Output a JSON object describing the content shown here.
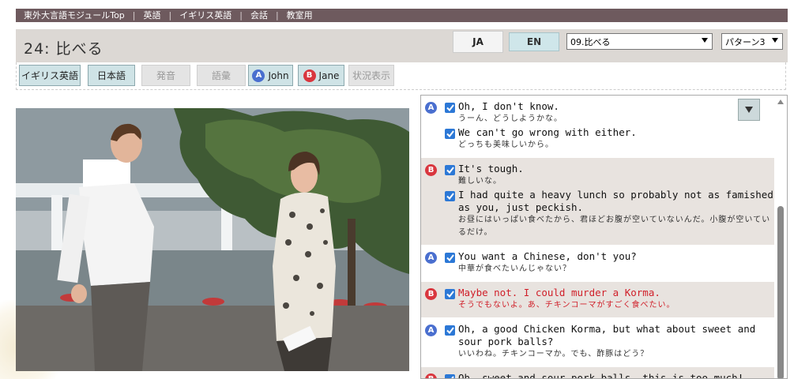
{
  "nav": {
    "items": [
      "東外大言語モジュールTop",
      "英語",
      "イギリス英語",
      "会話",
      "教室用"
    ]
  },
  "header": {
    "title": "24: 比べる",
    "lang_ja": "JA",
    "lang_en": "EN",
    "chapter_select": "09.比べる",
    "pattern_select": "パターン3"
  },
  "toolbar": {
    "british": "イギリス英語",
    "japanese": "日本語",
    "pronunciation": "発音",
    "vocabulary": "語彙",
    "john": "John",
    "jane": "Jane",
    "situation": "状況表示",
    "badge_a": "A",
    "badge_b": "B"
  },
  "transcript": {
    "groups": [
      {
        "speaker": "A",
        "lines": [
          {
            "en": "Oh, I don't know.",
            "ja": "うーん、どうしようかな。"
          },
          {
            "en": "We can't go wrong with either.",
            "ja": "どっちも美味しいから。"
          }
        ]
      },
      {
        "speaker": "B",
        "lines": [
          {
            "en": "It's tough.",
            "ja": "難しいな。"
          },
          {
            "en": "I had quite a heavy lunch so probably not as famished as you, just peckish.",
            "ja": "お昼にはいっぱい食べたから、君ほどお腹が空いていないんだ。小腹が空いているだけ。"
          }
        ]
      },
      {
        "speaker": "A",
        "lines": [
          {
            "en": "You want a Chinese, don't you?",
            "ja": "中華が食べたいんじゃない？"
          }
        ]
      },
      {
        "speaker": "B",
        "highlight": true,
        "lines": [
          {
            "en": "Maybe not. I could murder a Korma.",
            "ja": "そうでもないよ。あ、チキンコーマがすごく食べたい。"
          }
        ]
      },
      {
        "speaker": "A",
        "lines": [
          {
            "en": "Oh, a good Chicken Korma, but what about sweet and sour pork balls?",
            "ja": "いいわね。チキンコーマか。でも、酢豚はどう？"
          }
        ]
      },
      {
        "speaker": "B",
        "lines": [
          {
            "en": "Oh, sweet and sour pork balls, this is too much!",
            "ja": ""
          }
        ]
      }
    ]
  },
  "colors": {
    "nav_bg": "#6e5a5e",
    "badge_a": "#4a6fcf",
    "badge_b": "#d9363e",
    "highlight_text": "#d0202a"
  }
}
